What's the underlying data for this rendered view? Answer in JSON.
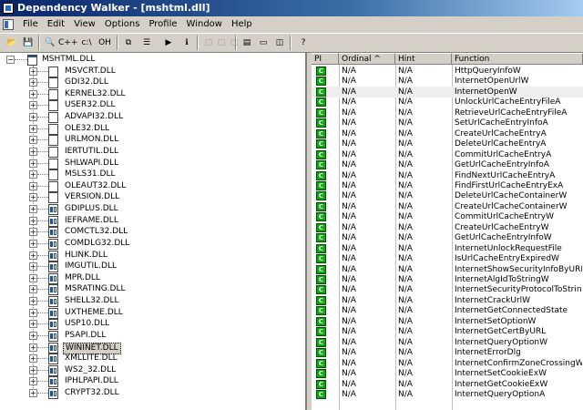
{
  "window": {
    "title": "Dependency Walker - [mshtml.dll]"
  },
  "menu": [
    "File",
    "Edit",
    "View",
    "Options",
    "Profile",
    "Window",
    "Help"
  ],
  "toolbar": {
    "buttons": [
      {
        "name": "open-button",
        "glyph": "📂"
      },
      {
        "name": "save-button",
        "glyph": "💾"
      },
      {
        "name": "find-button",
        "glyph": "🔍"
      },
      {
        "name": "undecorate-button",
        "glyph": "C++"
      },
      {
        "name": "path-button",
        "glyph": "c:\\"
      },
      {
        "name": "ordinal-button",
        "glyph": "OH"
      },
      {
        "name": "copy-button",
        "glyph": "⧉"
      },
      {
        "name": "properties-button",
        "glyph": "☰"
      },
      {
        "name": "profile-button",
        "glyph": "▶"
      },
      {
        "name": "system-info-button",
        "glyph": "ℹ"
      },
      {
        "name": "cascade-button",
        "glyph": "▤"
      },
      {
        "name": "tile-horizontal-button",
        "glyph": "▭"
      },
      {
        "name": "tile-vertical-button",
        "glyph": "◫"
      },
      {
        "name": "help-button",
        "glyph": "?"
      }
    ]
  },
  "tree": {
    "root": "MSHTML.DLL",
    "children": [
      {
        "label": "MSVCRT.DLL",
        "icon": "dll"
      },
      {
        "label": "GDI32.DLL",
        "icon": "dll"
      },
      {
        "label": "KERNEL32.DLL",
        "icon": "dll"
      },
      {
        "label": "USER32.DLL",
        "icon": "dll"
      },
      {
        "label": "ADVAPI32.DLL",
        "icon": "dll"
      },
      {
        "label": "OLE32.DLL",
        "icon": "dll"
      },
      {
        "label": "URLMON.DLL",
        "icon": "dll"
      },
      {
        "label": "IERTUTIL.DLL",
        "icon": "dll"
      },
      {
        "label": "SHLWAPI.DLL",
        "icon": "dll"
      },
      {
        "label": "MSLS31.DLL",
        "icon": "dll"
      },
      {
        "label": "OLEAUT32.DLL",
        "icon": "dll"
      },
      {
        "label": "VERSION.DLL",
        "icon": "dll"
      },
      {
        "label": "GDIPLUS.DLL",
        "icon": "dll3"
      },
      {
        "label": "IEFRAME.DLL",
        "icon": "dll3"
      },
      {
        "label": "COMCTL32.DLL",
        "icon": "dll3"
      },
      {
        "label": "COMDLG32.DLL",
        "icon": "dll3"
      },
      {
        "label": "HLINK.DLL",
        "icon": "dll3"
      },
      {
        "label": "IMGUTIL.DLL",
        "icon": "dll3"
      },
      {
        "label": "MPR.DLL",
        "icon": "dll3"
      },
      {
        "label": "MSRATING.DLL",
        "icon": "dll3"
      },
      {
        "label": "SHELL32.DLL",
        "icon": "dll3"
      },
      {
        "label": "UXTHEME.DLL",
        "icon": "dll3"
      },
      {
        "label": "USP10.DLL",
        "icon": "dll3"
      },
      {
        "label": "PSAPI.DLL",
        "icon": "dll3"
      },
      {
        "label": "WININET.DLL",
        "icon": "dll3",
        "selected": true
      },
      {
        "label": "XMLLITE.DLL",
        "icon": "dll3"
      },
      {
        "label": "WS2_32.DLL",
        "icon": "dll3"
      },
      {
        "label": "IPHLPAPI.DLL",
        "icon": "dll3"
      },
      {
        "label": "CRYPT32.DLL",
        "icon": "dll3"
      }
    ]
  },
  "functions": {
    "columns": [
      "PI",
      "Ordinal ^",
      "Hint",
      "Function"
    ],
    "pi_badge": "C",
    "rows": [
      {
        "ordinal": "N/A",
        "hint": "N/A",
        "function": "HttpQueryInfoW"
      },
      {
        "ordinal": "N/A",
        "hint": "N/A",
        "function": "InternetOpenUrlW"
      },
      {
        "ordinal": "N/A",
        "hint": "N/A",
        "function": "InternetOpenW",
        "highlight": true
      },
      {
        "ordinal": "N/A",
        "hint": "N/A",
        "function": "UnlockUrlCacheEntryFileA"
      },
      {
        "ordinal": "N/A",
        "hint": "N/A",
        "function": "RetrieveUrlCacheEntryFileA"
      },
      {
        "ordinal": "N/A",
        "hint": "N/A",
        "function": "SetUrlCacheEntryInfoA"
      },
      {
        "ordinal": "N/A",
        "hint": "N/A",
        "function": "CreateUrlCacheEntryA"
      },
      {
        "ordinal": "N/A",
        "hint": "N/A",
        "function": "DeleteUrlCacheEntryA"
      },
      {
        "ordinal": "N/A",
        "hint": "N/A",
        "function": "CommitUrlCacheEntryA"
      },
      {
        "ordinal": "N/A",
        "hint": "N/A",
        "function": "GetUrlCacheEntryInfoA"
      },
      {
        "ordinal": "N/A",
        "hint": "N/A",
        "function": "FindNextUrlCacheEntryA"
      },
      {
        "ordinal": "N/A",
        "hint": "N/A",
        "function": "FindFirstUrlCacheEntryExA"
      },
      {
        "ordinal": "N/A",
        "hint": "N/A",
        "function": "DeleteUrlCacheContainerW"
      },
      {
        "ordinal": "N/A",
        "hint": "N/A",
        "function": "CreateUrlCacheContainerW"
      },
      {
        "ordinal": "N/A",
        "hint": "N/A",
        "function": "CommitUrlCacheEntryW"
      },
      {
        "ordinal": "N/A",
        "hint": "N/A",
        "function": "CreateUrlCacheEntryW"
      },
      {
        "ordinal": "N/A",
        "hint": "N/A",
        "function": "GetUrlCacheEntryInfoW"
      },
      {
        "ordinal": "N/A",
        "hint": "N/A",
        "function": "InternetUnlockRequestFile"
      },
      {
        "ordinal": "N/A",
        "hint": "N/A",
        "function": "IsUrlCacheEntryExpiredW"
      },
      {
        "ordinal": "N/A",
        "hint": "N/A",
        "function": "InternetShowSecurityInfoByURLW"
      },
      {
        "ordinal": "N/A",
        "hint": "N/A",
        "function": "InternetAlgIdToStringW"
      },
      {
        "ordinal": "N/A",
        "hint": "N/A",
        "function": "InternetSecurityProtocolToStringW"
      },
      {
        "ordinal": "N/A",
        "hint": "N/A",
        "function": "InternetCrackUrlW"
      },
      {
        "ordinal": "N/A",
        "hint": "N/A",
        "function": "InternetGetConnectedState"
      },
      {
        "ordinal": "N/A",
        "hint": "N/A",
        "function": "InternetSetOptionW"
      },
      {
        "ordinal": "N/A",
        "hint": "N/A",
        "function": "InternetGetCertByURL"
      },
      {
        "ordinal": "N/A",
        "hint": "N/A",
        "function": "InternetQueryOptionW"
      },
      {
        "ordinal": "N/A",
        "hint": "N/A",
        "function": "InternetErrorDlg"
      },
      {
        "ordinal": "N/A",
        "hint": "N/A",
        "function": "InternetConfirmZoneCrossingW"
      },
      {
        "ordinal": "N/A",
        "hint": "N/A",
        "function": "InternetSetCookieExW"
      },
      {
        "ordinal": "N/A",
        "hint": "N/A",
        "function": "InternetGetCookieExW"
      },
      {
        "ordinal": "N/A",
        "hint": "N/A",
        "function": "InternetQueryOptionA"
      }
    ]
  }
}
